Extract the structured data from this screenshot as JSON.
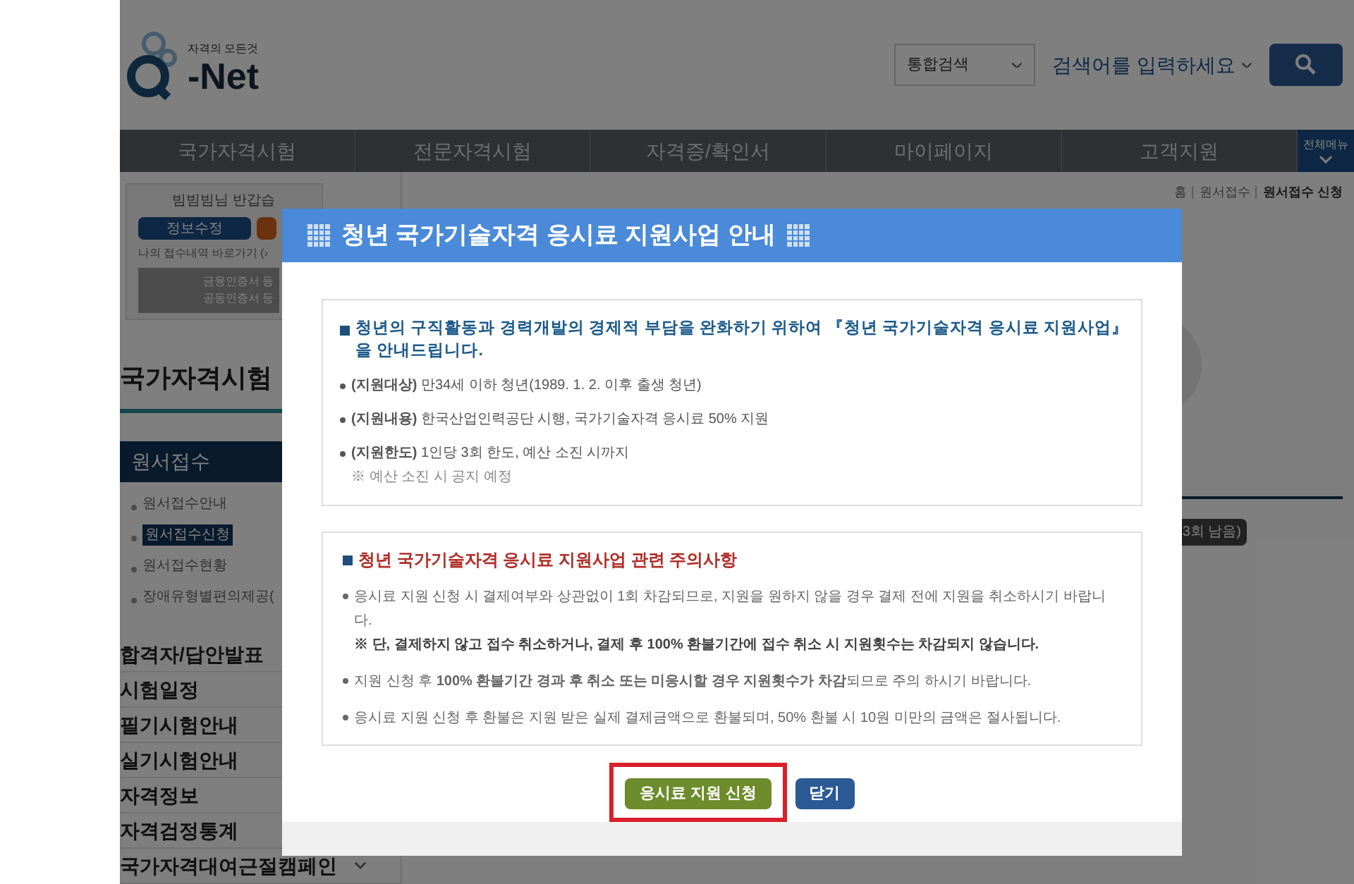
{
  "header": {
    "logo": {
      "tagline": "자격의 모든것",
      "name": "-Net"
    },
    "search": {
      "scope": "통합검색",
      "query_hint": "검색어를 입력하세요"
    }
  },
  "nav": {
    "items": [
      "국가자격시험",
      "전문자격시험",
      "자격증/확인서",
      "마이페이지",
      "고객지원"
    ],
    "all_menu": "전체메뉴"
  },
  "sidebar": {
    "greeting": "빔빔빔님 반갑습",
    "buttons": [
      "정보수정"
    ],
    "link": "나의 접수내역 바로가기 (›",
    "cert_lines": [
      "금융인증서 등",
      "공동인증서 등"
    ],
    "section_title": "국가자격시험",
    "menu_heading": "원서접수",
    "subitems": [
      {
        "label": "원서접수안내",
        "selected": false
      },
      {
        "label": "원서접수신청",
        "selected": true
      },
      {
        "label": "원서접수현황",
        "selected": false
      },
      {
        "label": "장애유형별편의제공(",
        "selected": false
      }
    ],
    "items": [
      {
        "label": "합격자/답안발표",
        "kind": "link"
      },
      {
        "label": "시험일정",
        "kind": "link"
      },
      {
        "label": "필기시험안내",
        "kind": "link"
      },
      {
        "label": "실기시험안내",
        "kind": "link"
      },
      {
        "label": "자격정보",
        "kind": "link"
      },
      {
        "label": "자격검정통계",
        "kind": "link"
      },
      {
        "label": "국가자격대여근절캠페인",
        "kind": "dropdown"
      }
    ]
  },
  "breadcrumb": [
    "홈",
    "원서접수",
    "원서접수 신청"
  ],
  "remaining_badge": "3회 남음)",
  "modal": {
    "title": "청년 국가기술자격 응시료 지원사업 안내",
    "intro": "청년의 구직활동과 경력개발의 경제적 부담을 완화하기 위하여 『청년 국가기술자격 응시료 지원사업』을 안내드립니다.",
    "items": [
      {
        "text": "**(지원대상)** 만34세 이하 청년(1989. 1. 2. 이후 출생 청년)"
      },
      {
        "text": "**(지원내용)** 한국산업인력공단 시행, 국가기술자격 응시료 50% 지원"
      },
      {
        "text": "**(지원한도)** 1인당 3회 한도, 예산 소진 시까지",
        "note": "※ 예산 소진 시 공지 예정"
      }
    ],
    "caution_title": "청년 국가기술자격 응시료 지원사업 관련 주의사항",
    "cautions": [
      {
        "text": "응시료 지원 신청 시 결제여부와 상관없이 1회 차감되므로, 지원을 원하지 않을 경우 결제 전에 지원을 취소하시기 바랍니다.",
        "note": "※ 단, 결제하지 않고 접수 취소하거나, 결제 후 100% 환불기간에 접수 취소 시 지원횟수는 차감되지 않습니다."
      },
      {
        "text": "지원 신청 후 **100% 환불기간 경과 후 취소 또는 미응시할 경우 지원횟수가 차감**되므로 주의 하시기 바랍니다."
      },
      {
        "text": "응시료 지원 신청 후 환불은 지원 받은 실제 결제금액으로 환불되며, 50% 환불 시 10원 미만의 금액은 절사됩니다."
      }
    ],
    "buttons": [
      {
        "label": "응시료 지원 신청",
        "kind": "primary",
        "highlighted": true
      },
      {
        "label": "닫기",
        "kind": "secondary",
        "highlighted": false
      }
    ]
  }
}
